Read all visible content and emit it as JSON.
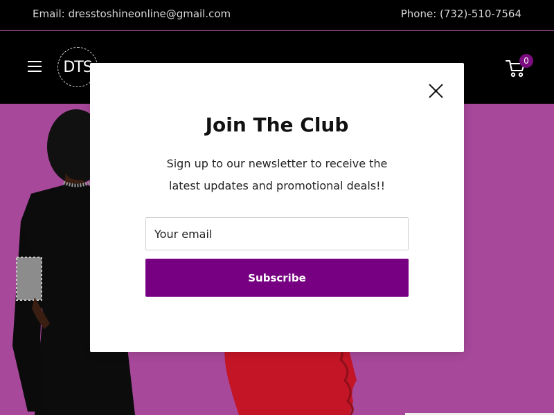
{
  "topbar": {
    "email": "Email: dresstoshineonline@gmail.com",
    "phone": "Phone: (732)-510-7564"
  },
  "header": {
    "logo_text": "DTS",
    "cart_count": "0",
    "icons": [
      "hamburger-menu-icon",
      "cart-icon"
    ]
  },
  "popup": {
    "title": "Join The Club",
    "description": "Sign up to our newsletter to receive the latest updates and promotional deals!!",
    "email_placeholder": "Your email",
    "subscribe_label": "Subscribe",
    "close_icon": "close-icon"
  },
  "colors": {
    "topbar_bg": "#000000",
    "hero_bg": "#a7489a",
    "subscribe_bg": "#760081",
    "cart_badge_bg": "#7b0d80"
  }
}
